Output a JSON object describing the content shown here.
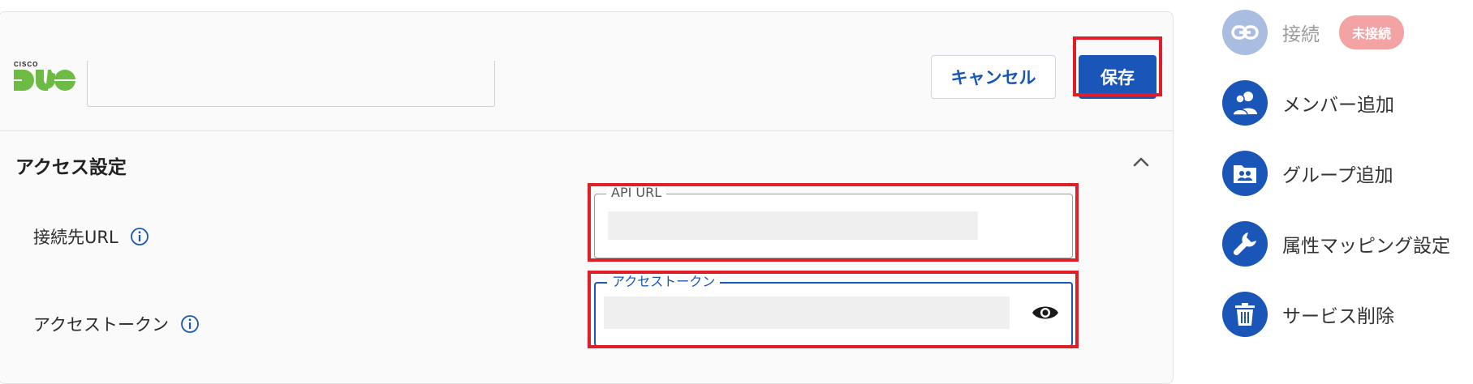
{
  "header": {
    "logo_brand_small": "CISCO",
    "logo_brand_large": "DUO",
    "cancel_label": "キャンセル",
    "save_label": "保存"
  },
  "access_settings": {
    "title": "アクセス設定",
    "url_label": "接続先URL",
    "token_label": "アクセストークン",
    "api_url_field": {
      "legend": "API URL",
      "value": ""
    },
    "access_token_field": {
      "legend": "アクセストークン",
      "value": ""
    }
  },
  "sidebar": {
    "items": [
      {
        "label": "接続",
        "icon": "link-icon",
        "badge": "未接続",
        "disabled": true
      },
      {
        "label": "メンバー追加",
        "icon": "users-icon"
      },
      {
        "label": "グループ追加",
        "icon": "group-folder-icon"
      },
      {
        "label": "属性マッピング設定",
        "icon": "wrench-icon"
      },
      {
        "label": "サービス削除",
        "icon": "trash-icon"
      }
    ]
  },
  "colors": {
    "primary": "#1a56b8",
    "highlight": "#e01e27",
    "duo_green": "#6dbb45",
    "badge_red": "#f3a3a3"
  }
}
